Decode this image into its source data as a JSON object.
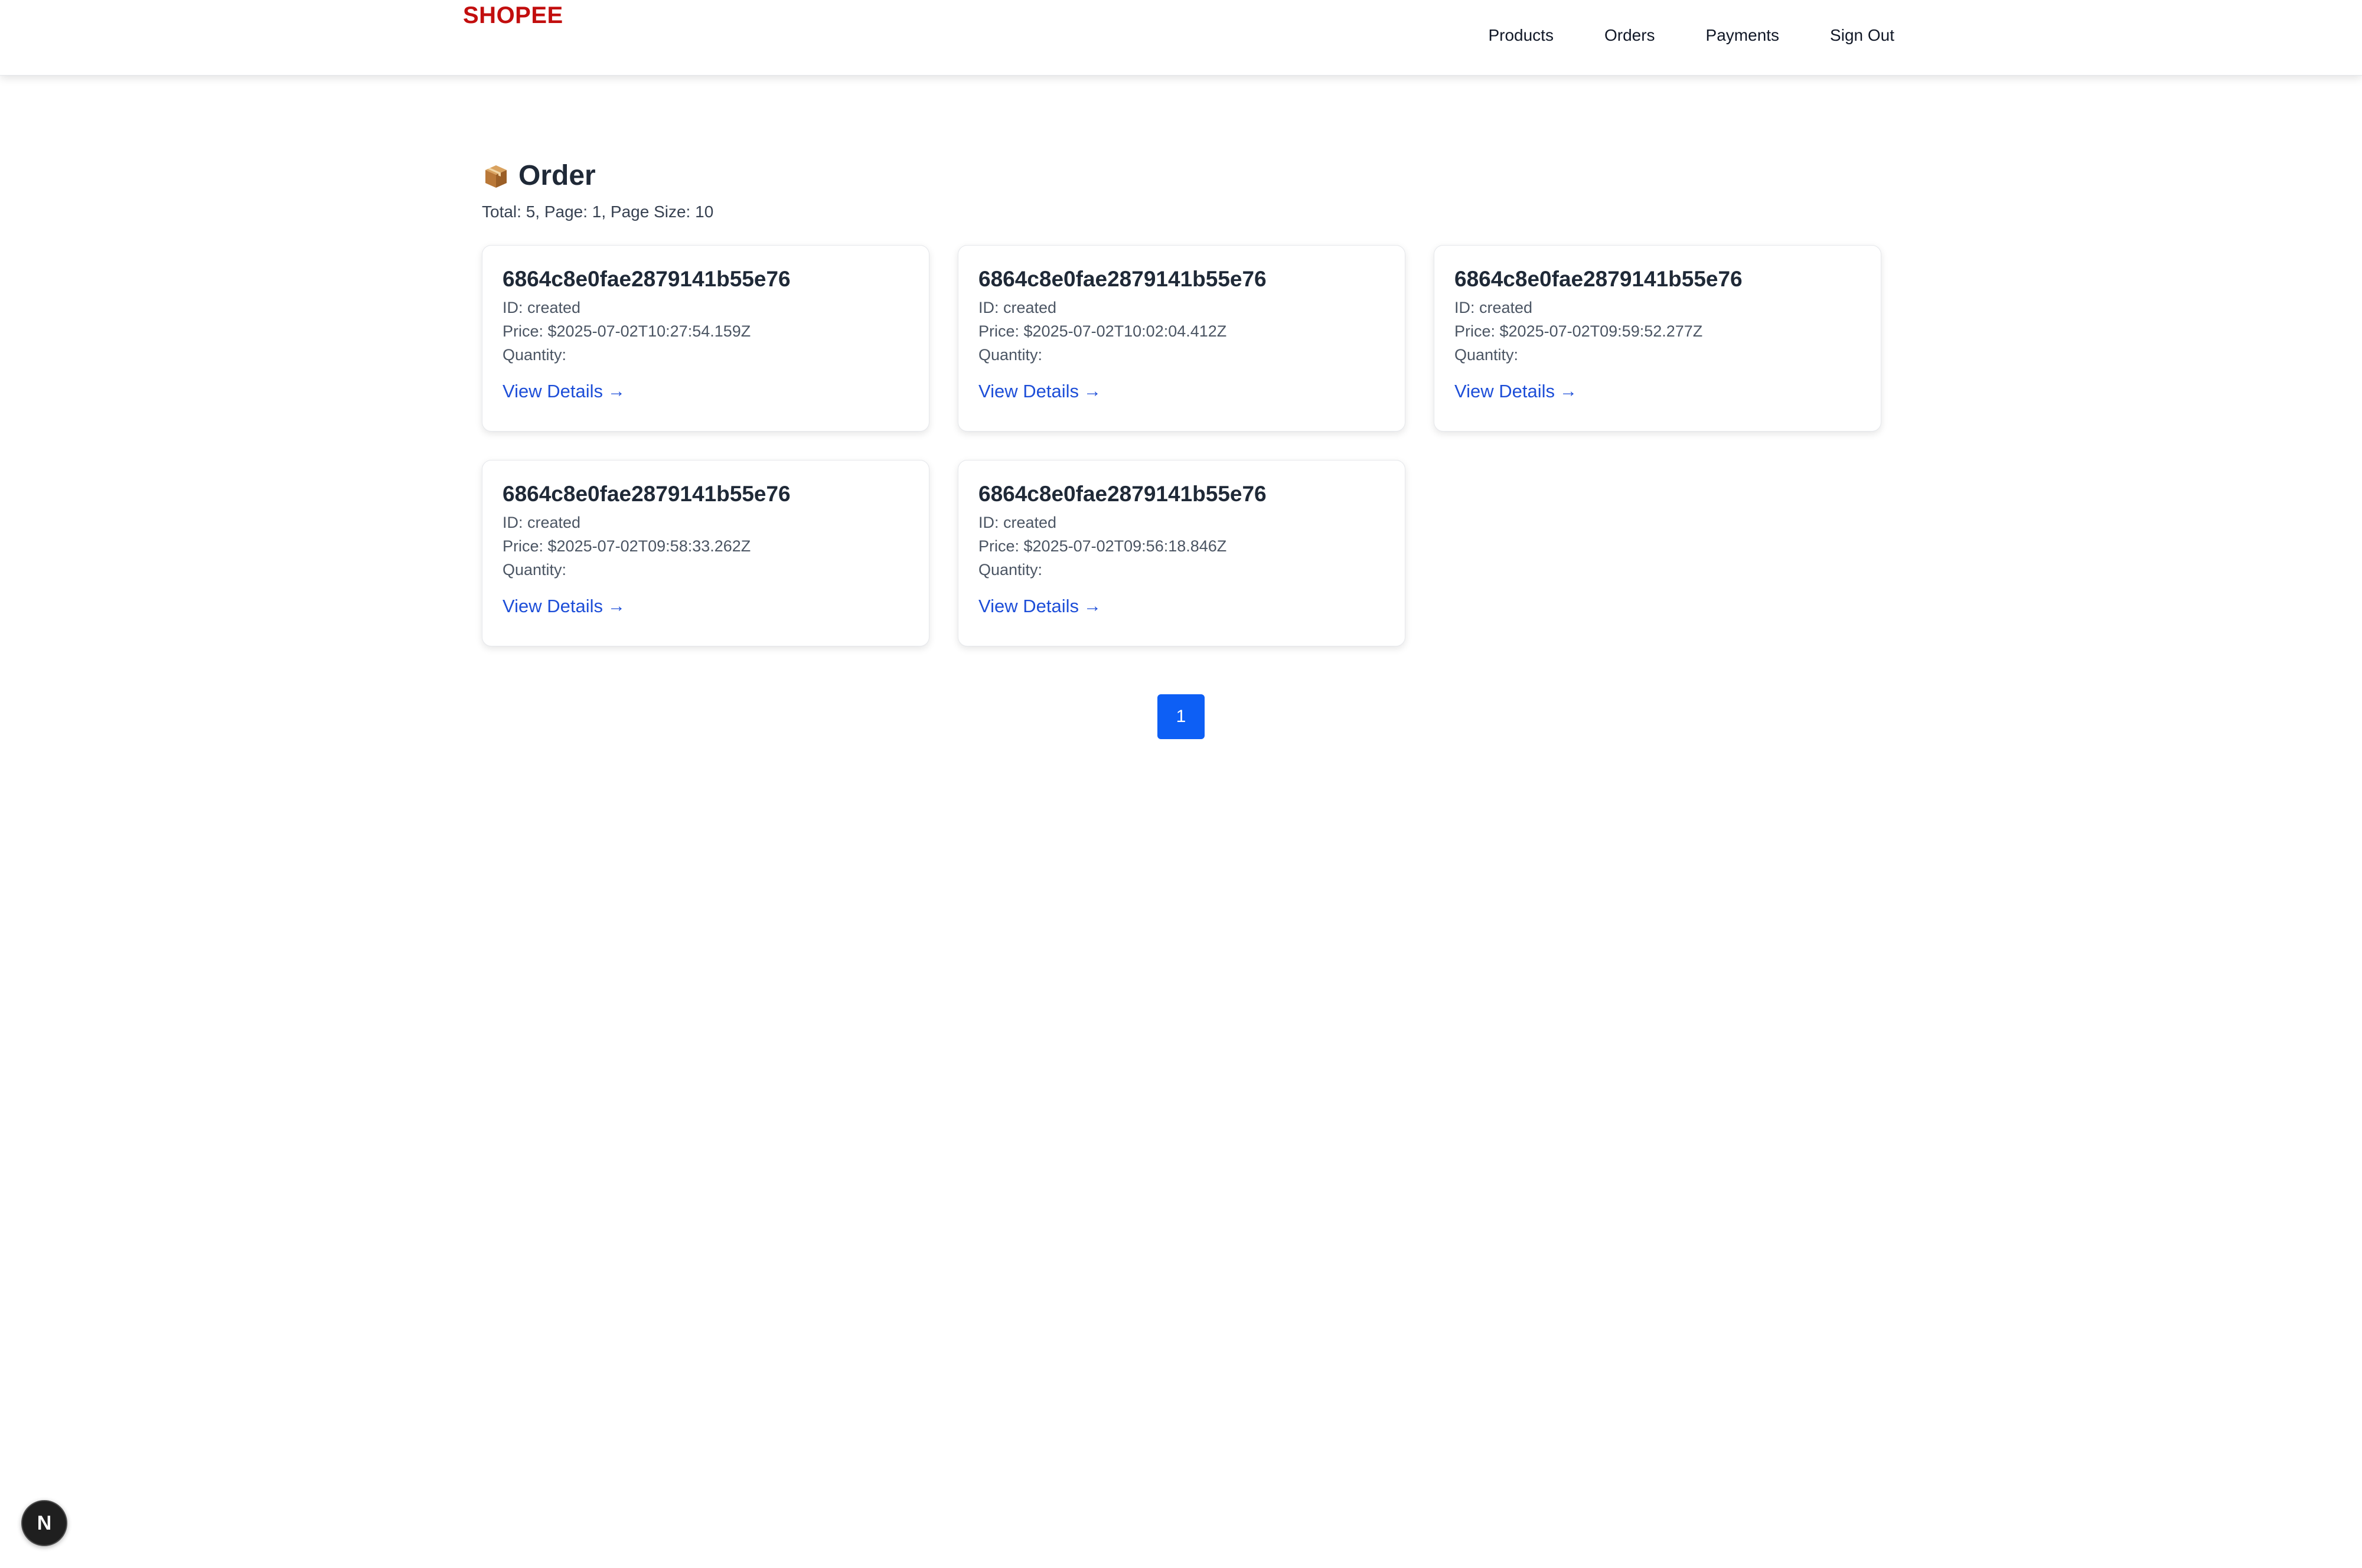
{
  "header": {
    "brand": "SHOPEE",
    "nav": [
      "Products",
      "Orders",
      "Payments",
      "Sign Out"
    ]
  },
  "page": {
    "title": "Order",
    "title_icon": "package-icon",
    "summary": "Total: 5, Page: 1, Page Size: 10"
  },
  "orders": [
    {
      "title": "6864c8e0fae2879141b55e76",
      "id_line": "ID: created",
      "price_line": "Price: $2025-07-02T10:27:54.159Z",
      "quantity_line": "Quantity:",
      "link": "View Details"
    },
    {
      "title": "6864c8e0fae2879141b55e76",
      "id_line": "ID: created",
      "price_line": "Price: $2025-07-02T10:02:04.412Z",
      "quantity_line": "Quantity:",
      "link": "View Details"
    },
    {
      "title": "6864c8e0fae2879141b55e76",
      "id_line": "ID: created",
      "price_line": "Price: $2025-07-02T09:59:52.277Z",
      "quantity_line": "Quantity:",
      "link": "View Details"
    },
    {
      "title": "6864c8e0fae2879141b55e76",
      "id_line": "ID: created",
      "price_line": "Price: $2025-07-02T09:58:33.262Z",
      "quantity_line": "Quantity:",
      "link": "View Details"
    },
    {
      "title": "6864c8e0fae2879141b55e76",
      "id_line": "ID: created",
      "price_line": "Price: $2025-07-02T09:56:18.846Z",
      "quantity_line": "Quantity:",
      "link": "View Details"
    }
  ],
  "pagination": {
    "current_page": "1"
  },
  "badge": {
    "label": "N"
  },
  "colors": {
    "brand": "#c20e0e",
    "link": "#1d4ed8",
    "page_button": "#0d5ff5"
  }
}
